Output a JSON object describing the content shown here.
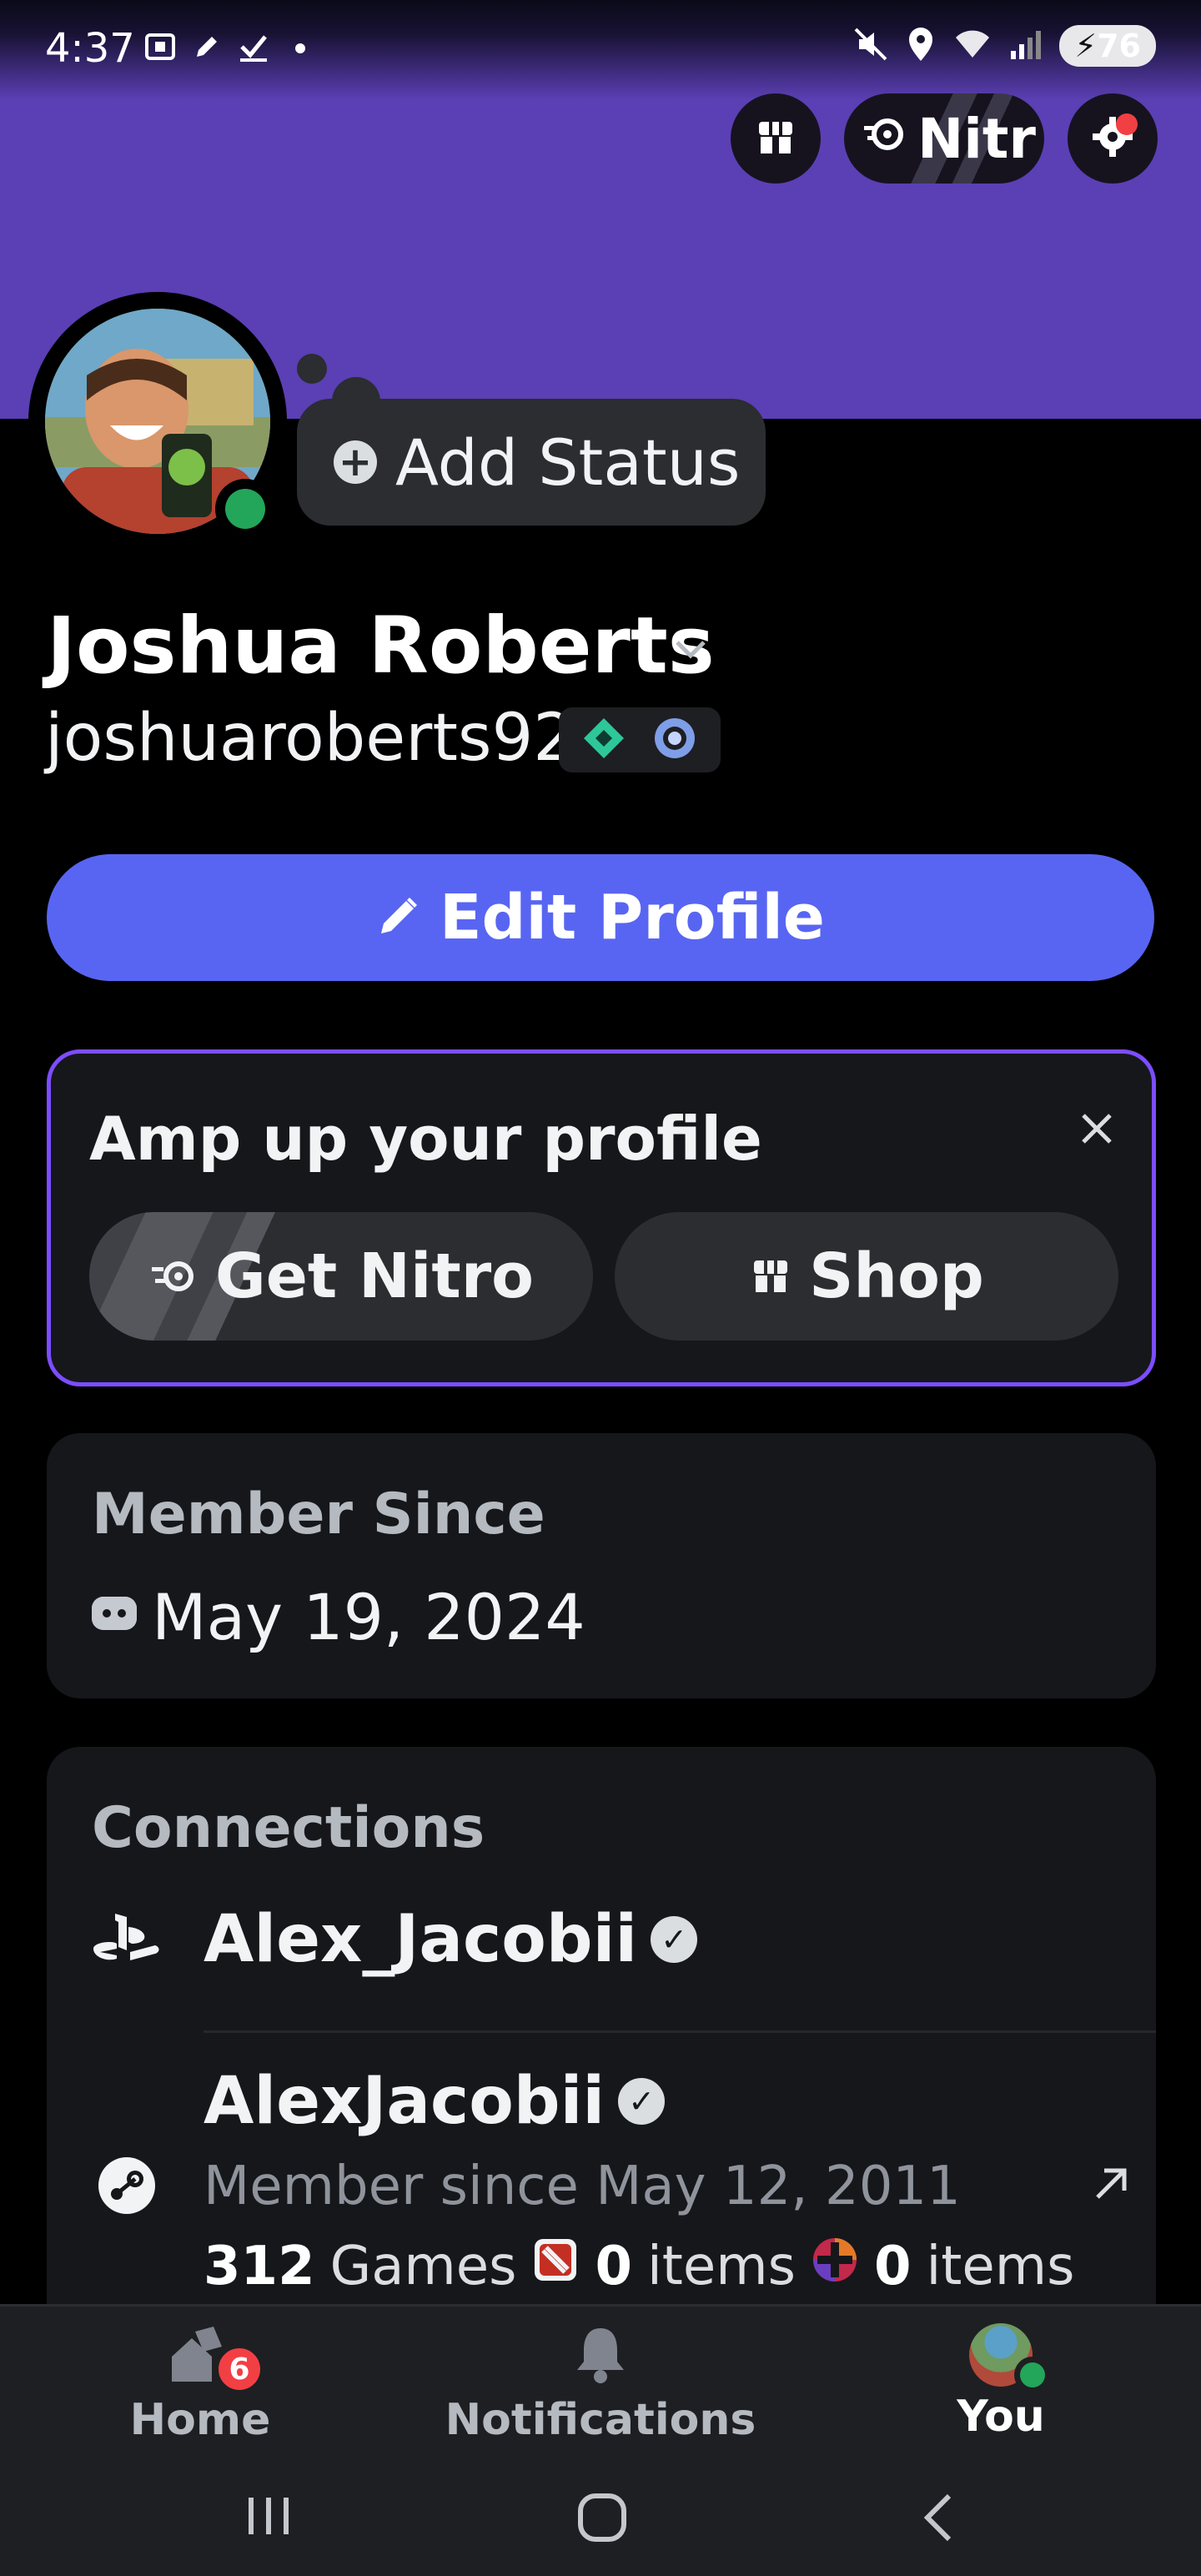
{
  "status_bar": {
    "time": "4:37",
    "battery": "76",
    "left_icons": [
      "screenshot-icon",
      "edit-icon",
      "check-icon",
      "dot-icon"
    ],
    "right_icons": [
      "mute-icon",
      "location-icon",
      "wifi-icon",
      "signal-icon"
    ]
  },
  "header_actions": {
    "shop_icon": "shop-icon",
    "nitro_label": "Nitr",
    "settings_icon": "gear-icon"
  },
  "profile": {
    "add_status_label": "Add Status",
    "display_name": "Joshua Roberts",
    "username": "joshuaroberts92",
    "badges": [
      "quest-badge",
      "orbs-badge"
    ],
    "edit_profile_label": "Edit Profile"
  },
  "amp_card": {
    "title": "Amp up your profile",
    "get_nitro_label": "Get Nitro",
    "shop_label": "Shop"
  },
  "member_since": {
    "label": "Member Since",
    "date": "May 19, 2024"
  },
  "connections": {
    "label": "Connections",
    "items": [
      {
        "platform": "playstation",
        "name": "Alex_Jacobii",
        "verified": true
      },
      {
        "platform": "steam",
        "name": "AlexJacobii",
        "verified": true,
        "member_since": "Member since May 12, 2011",
        "games_count": "312",
        "games_label": "Games",
        "dota_count": "0",
        "dota_label": "items",
        "tf_count": "0",
        "tf_label": "items"
      }
    ]
  },
  "tabs": [
    {
      "label": "Home",
      "badge": "6"
    },
    {
      "label": "Notifications"
    },
    {
      "label": "You"
    }
  ],
  "colors": {
    "banner": "#5b3fb5",
    "blurple": "#5865f2",
    "online": "#23a55a",
    "danger": "#f23f43"
  }
}
